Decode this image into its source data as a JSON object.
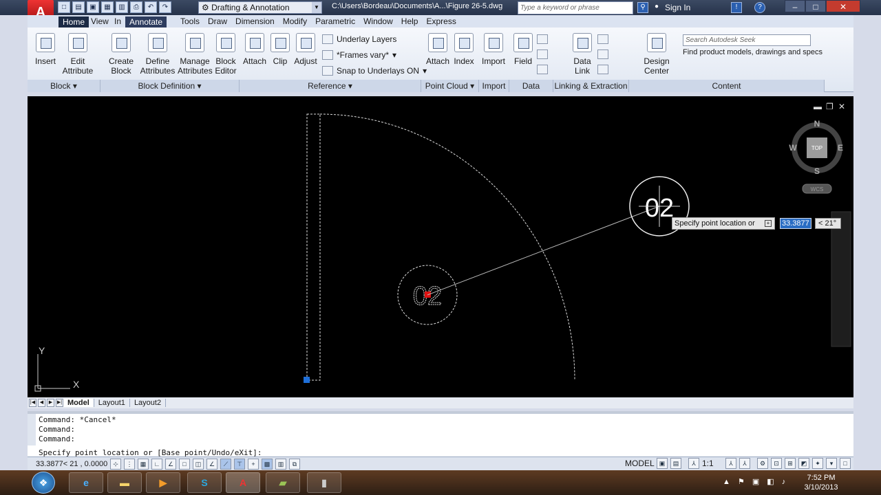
{
  "titlebar": {
    "workspace": "Drafting & Annotation",
    "filepath": "C:\\Users\\Bordeau\\Documents\\A...\\Figure 26-5.dwg",
    "search_placeholder": "Type a keyword or phrase",
    "signin": "Sign In"
  },
  "menubar": {
    "items": [
      "View",
      "Tools",
      "Draw",
      "Dimension",
      "Modify",
      "Parametric",
      "Window",
      "Help",
      "Express"
    ],
    "tab_home": "Home",
    "tab_insert_partial": "In",
    "tab_annotate": "Annotate"
  },
  "ribbon": {
    "block": {
      "insert": "Insert",
      "edit_attr_1": "Edit",
      "edit_attr_2": "Attribute",
      "title": "Block ▾"
    },
    "block_def": {
      "create_1": "Create",
      "create_2": "Block",
      "define_1": "Define",
      "define_2": "Attributes",
      "manage_1": "Manage",
      "manage_2": "Attributes",
      "editor_1": "Block",
      "editor_2": "Editor",
      "title": "Block Definition ▾"
    },
    "reference": {
      "attach": "Attach",
      "clip": "Clip",
      "adjust": "Adjust",
      "underlay_layers": "Underlay Layers",
      "frames_vary": "*Frames vary*",
      "snap_underlays": "Snap to Underlays ON",
      "title": "Reference ▾"
    },
    "point_cloud": {
      "attach": "Attach",
      "index": "Index",
      "title": "Point Cloud ▾"
    },
    "import": {
      "label": "Import",
      "title": "Import"
    },
    "data": {
      "field": "Field",
      "title": "Data"
    },
    "linking": {
      "data_link_1": "Data",
      "data_link_2": "Link",
      "title": "Linking & Extraction"
    },
    "content": {
      "design_center": "Design Center",
      "seek_placeholder": "Search Autodesk Seek",
      "seek_text": "Find product models, drawings and specs",
      "title": "Content"
    }
  },
  "canvas": {
    "balloon_text_1": "02",
    "balloon_text_2": "02",
    "tooltip": "Specify point location or",
    "dyn_value": "33.3877",
    "dyn_angle": "< 21°",
    "viewcube": {
      "n": "N",
      "s": "S",
      "e": "E",
      "w": "W",
      "top": "TOP",
      "wcs": "WCS"
    },
    "ucs": {
      "x": "X",
      "y": "Y"
    }
  },
  "layout_tabs": [
    "Model",
    "Layout1",
    "Layout2"
  ],
  "command": {
    "history": [
      "Command: *Cancel*",
      "Command:",
      "Command:"
    ],
    "prompt": "Specify point location or [Base point/Undo/eXit]:"
  },
  "status": {
    "coords": "33.3877< 21 , 0.0000",
    "model": "MODEL",
    "scale": "1:1"
  },
  "taskbar": {
    "time": "7:52 PM",
    "date": "3/10/2013"
  }
}
